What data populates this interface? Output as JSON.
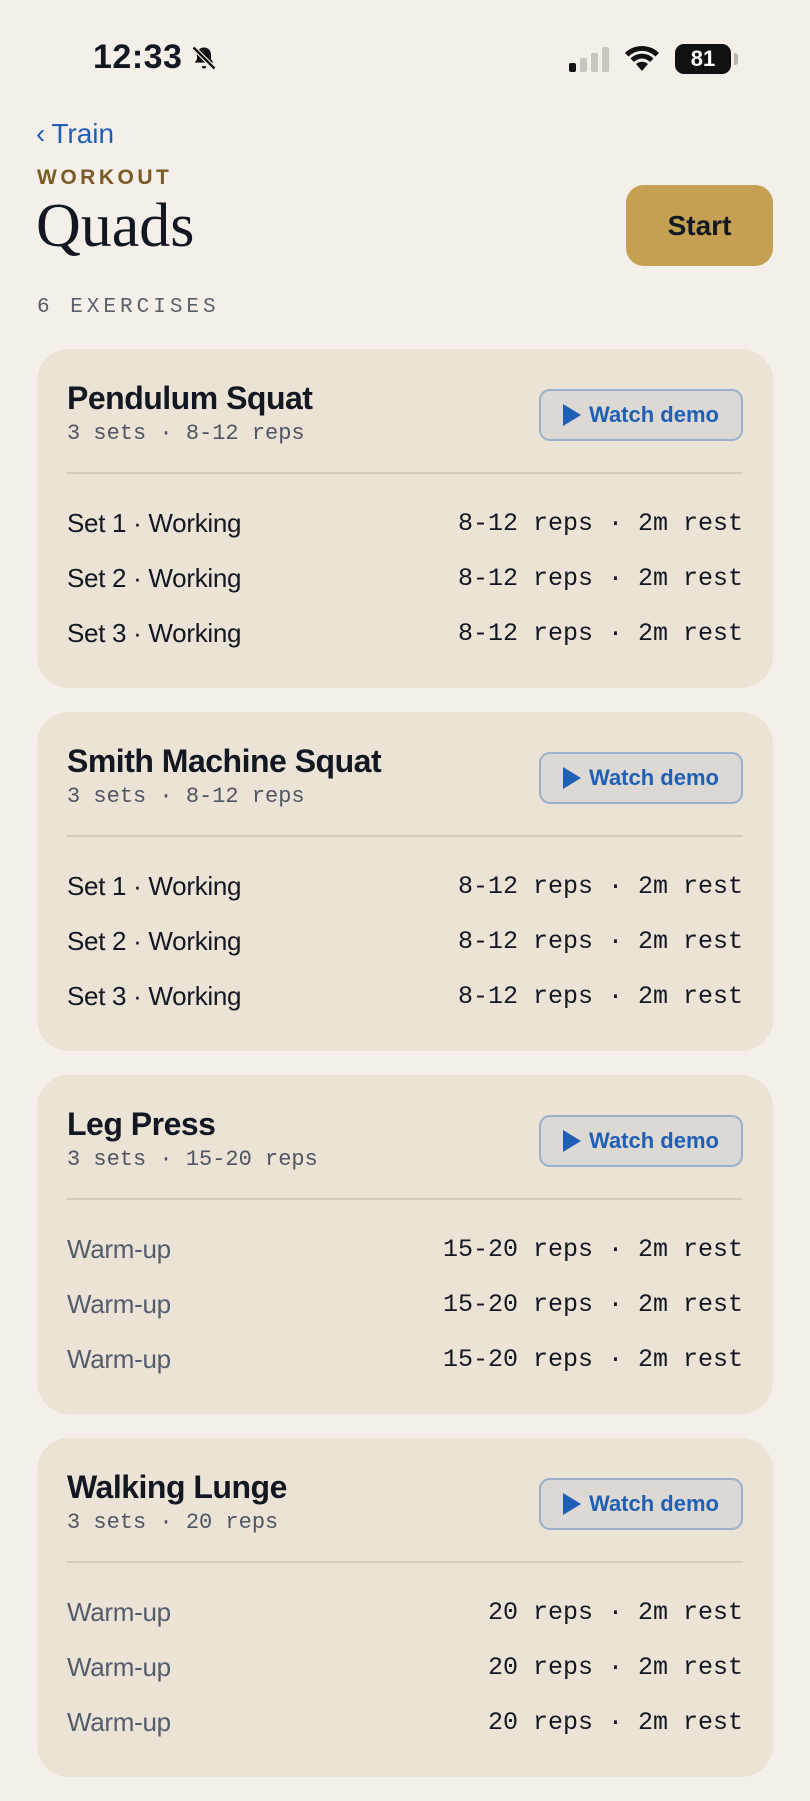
{
  "status": {
    "time": "12:33",
    "battery": "81",
    "icons": [
      "bell-slash-icon",
      "cellular-signal-icon",
      "wifi-icon",
      "battery-icon"
    ]
  },
  "header": {
    "back_label": "Train",
    "eyebrow": "WORKOUT",
    "title": "Quads",
    "start_label": "Start",
    "count_label": "6 EXERCISES"
  },
  "colors": {
    "background": "#f4efe8",
    "card": "#ebe3d6",
    "accent_gold": "#c6a052",
    "link_blue": "#1f5fb5",
    "eyebrow_brown": "#7a5a27"
  },
  "exercises": [
    {
      "name": "Pendulum Squat",
      "summary": "3 sets · 8-12 reps",
      "demo_label": "Watch demo",
      "sets": [
        {
          "label": "Set 1 · Working",
          "detail": "8-12 reps · 2m rest"
        },
        {
          "label": "Set 2 · Working",
          "detail": "8-12 reps · 2m rest"
        },
        {
          "label": "Set 3 · Working",
          "detail": "8-12 reps · 2m rest"
        }
      ]
    },
    {
      "name": "Smith Machine Squat",
      "summary": "3 sets · 8-12 reps",
      "demo_label": "Watch demo",
      "sets": [
        {
          "label": "Set 1 · Working",
          "detail": "8-12 reps · 2m rest"
        },
        {
          "label": "Set 2 · Working",
          "detail": "8-12 reps · 2m rest"
        },
        {
          "label": "Set 3 · Working",
          "detail": "8-12 reps · 2m rest"
        }
      ]
    },
    {
      "name": "Leg Press",
      "summary": "3 sets · 15-20 reps",
      "demo_label": "Watch demo",
      "sets": [
        {
          "label": "Warm-up",
          "detail": "15-20 reps · 2m rest"
        },
        {
          "label": "Warm-up",
          "detail": "15-20 reps · 2m rest"
        },
        {
          "label": "Warm-up",
          "detail": "15-20 reps · 2m rest"
        }
      ]
    },
    {
      "name": "Walking Lunge",
      "summary": "3 sets · 20 reps",
      "demo_label": "Watch demo",
      "sets": [
        {
          "label": "Warm-up",
          "detail": "20 reps · 2m rest"
        },
        {
          "label": "Warm-up",
          "detail": "20 reps · 2m rest"
        },
        {
          "label": "Warm-up",
          "detail": "20 reps · 2m rest"
        }
      ]
    }
  ]
}
